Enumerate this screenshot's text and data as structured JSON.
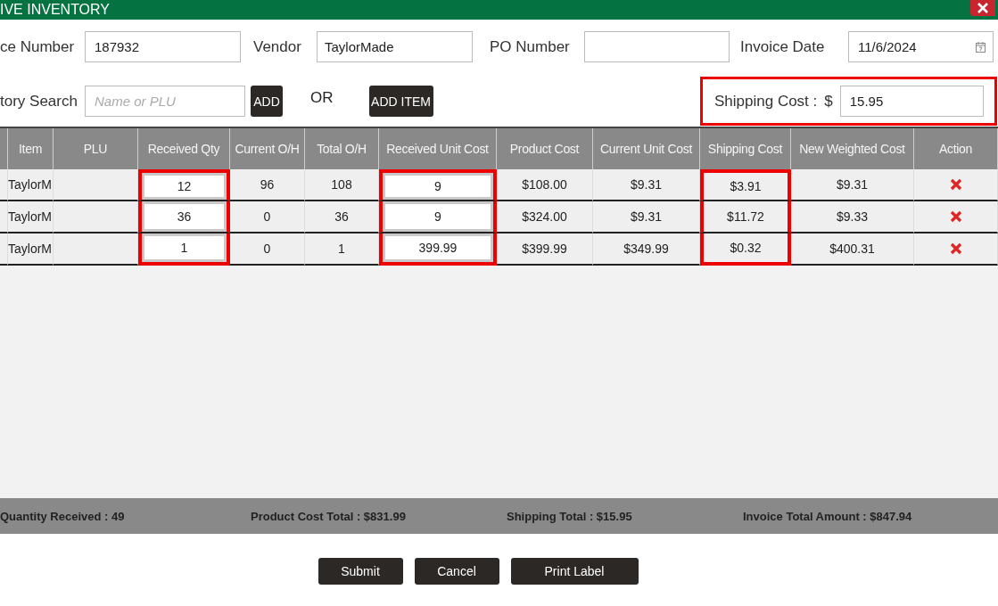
{
  "window": {
    "title": "IVE INVENTORY"
  },
  "form": {
    "fields": [
      {
        "label": "ce Number",
        "value": "187932",
        "kind": "text"
      },
      {
        "label": "Vendor",
        "value": "TaylorMade",
        "kind": "text"
      },
      {
        "label": "PO Number",
        "kind": "text"
      },
      {
        "label": "Invoice Date",
        "value": "11/6/2024",
        "kind": "date"
      }
    ],
    "search": {
      "label": "tory Search",
      "placeholder": "Name or PLU",
      "add_button": "ADD",
      "or_text": "OR",
      "add_item_button": "ADD ITEM"
    },
    "shipping": {
      "label": "Shipping Cost :",
      "currency": "$",
      "value": "15.95",
      "highlighted": true
    }
  },
  "table": {
    "columns": [
      {
        "title": "Item",
        "editable": false,
        "highlighted": false
      },
      {
        "title": "PLU",
        "editable": false,
        "highlighted": false
      },
      {
        "title": "Received Qty",
        "editable": true,
        "highlighted": true
      },
      {
        "title": "Current O/H",
        "editable": false,
        "highlighted": false
      },
      {
        "title": "Total O/H",
        "editable": false,
        "highlighted": false
      },
      {
        "title": "Received Unit Cost",
        "editable": true,
        "highlighted": true
      },
      {
        "title": "Product Cost",
        "editable": false,
        "highlighted": false
      },
      {
        "title": "Current Unit Cost",
        "editable": false,
        "highlighted": false
      },
      {
        "title": "Shipping Cost",
        "editable": false,
        "highlighted": true
      },
      {
        "title": "New Weighted Cost",
        "editable": false,
        "highlighted": false
      },
      {
        "title": "Action",
        "kind": "delete",
        "editable": false,
        "highlighted": false
      }
    ],
    "rows": [
      [
        "TaylorM",
        null,
        "12",
        "96",
        "108",
        "9",
        "$108.00",
        "$9.31",
        "$3.91",
        "$9.31"
      ],
      [
        "TaylorM",
        null,
        "36",
        "0",
        "36",
        "9",
        "$324.00",
        "$9.31",
        "$11.72",
        "$9.33"
      ],
      [
        "TaylorM",
        null,
        "1",
        "0",
        "1",
        "399.99",
        "$399.99",
        "$349.99",
        "$0.32",
        "$400.31"
      ]
    ]
  },
  "totals": [
    "Quantity Received : 49",
    "Product Cost Total : $831.99",
    "Shipping Total : $15.95",
    "Invoice Total Amount : $847.94"
  ],
  "buttons": [
    "Submit",
    "Cancel",
    "Print Label"
  ]
}
